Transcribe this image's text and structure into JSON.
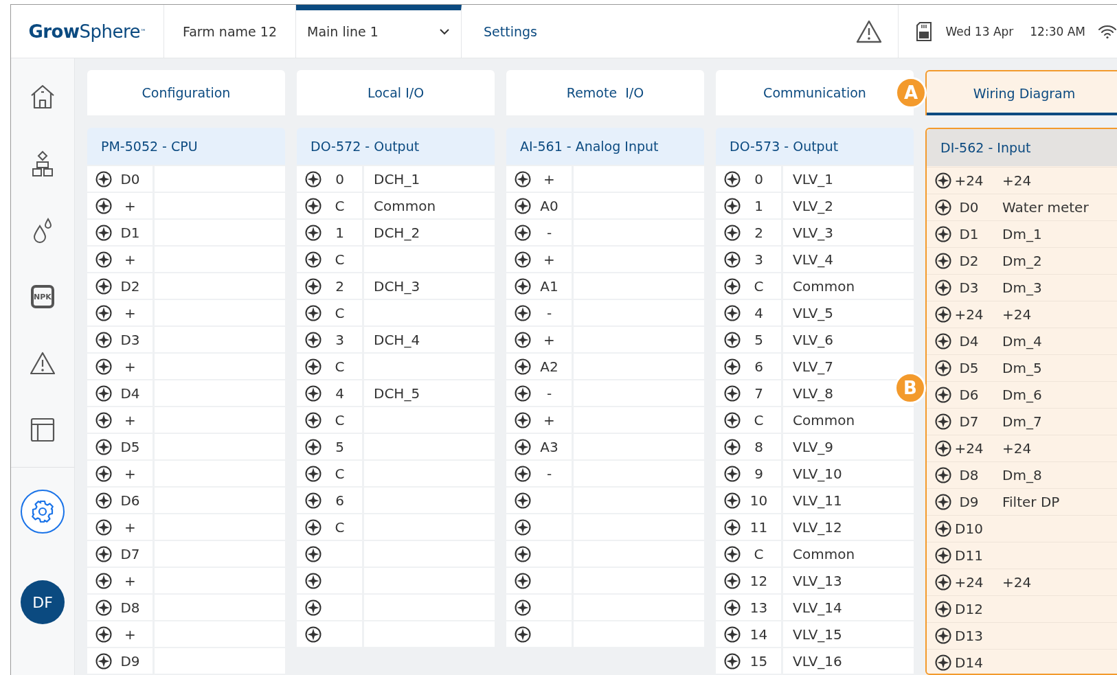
{
  "header": {
    "logo": "**Grow**Sphere$^{™}$",
    "farm": "Farm name 12",
    "line": {
      "label": "Main line 1",
      "selected": true
    },
    "settings": "Settings",
    "date": "Wed 13 Apr",
    "time": "12:30 AM"
  },
  "sidebar": {
    "items": [
      {
        "kind": "home",
        "selected": false
      },
      {
        "kind": "modules",
        "selected": false
      },
      {
        "kind": "drops",
        "selected": false
      },
      {
        "kind": "npk",
        "label": "NPK",
        "selected": false
      },
      {
        "kind": "alert",
        "selected": false
      },
      {
        "kind": "layout",
        "selected": false
      }
    ],
    "settings": {
      "selected": true
    },
    "avatar": "DF"
  },
  "tabs": [
    {
      "label": "Configuration",
      "selected": false
    },
    {
      "label": "Local I/O",
      "selected": false
    },
    {
      "label": "Remote  I/O",
      "selected": false
    },
    {
      "label": "Communication",
      "selected": false
    },
    {
      "label": "Wiring Diagram",
      "selected": true,
      "annotation": "A"
    }
  ],
  "modules": [
    {
      "title": "PM-5052 - CPU",
      "highlighted": false,
      "rows": [
        {
          "terminal": "D0",
          "name": ""
        },
        {
          "terminal": "+",
          "name": ""
        },
        {
          "terminal": "D1",
          "name": ""
        },
        {
          "terminal": "+",
          "name": ""
        },
        {
          "terminal": "D2",
          "name": ""
        },
        {
          "terminal": "+",
          "name": ""
        },
        {
          "terminal": "D3",
          "name": ""
        },
        {
          "terminal": "+",
          "name": ""
        },
        {
          "terminal": "D4",
          "name": ""
        },
        {
          "terminal": "+",
          "name": ""
        },
        {
          "terminal": "D5",
          "name": ""
        },
        {
          "terminal": "+",
          "name": ""
        },
        {
          "terminal": "D6",
          "name": ""
        },
        {
          "terminal": "+",
          "name": ""
        },
        {
          "terminal": "D7",
          "name": ""
        },
        {
          "terminal": "+",
          "name": ""
        },
        {
          "terminal": "D8",
          "name": ""
        },
        {
          "terminal": "+",
          "name": ""
        },
        {
          "terminal": "D9",
          "name": ""
        }
      ]
    },
    {
      "title": "DO-572 - Output",
      "highlighted": false,
      "rows": [
        {
          "terminal": "0",
          "name": "DCH_1"
        },
        {
          "terminal": "C",
          "name": "Common"
        },
        {
          "terminal": "1",
          "name": "DCH_2"
        },
        {
          "terminal": "C",
          "name": ""
        },
        {
          "terminal": "2",
          "name": "DCH_3"
        },
        {
          "terminal": "C",
          "name": ""
        },
        {
          "terminal": "3",
          "name": "DCH_4"
        },
        {
          "terminal": "C",
          "name": ""
        },
        {
          "terminal": "4",
          "name": "DCH_5"
        },
        {
          "terminal": "C",
          "name": ""
        },
        {
          "terminal": "5",
          "name": ""
        },
        {
          "terminal": "C",
          "name": ""
        },
        {
          "terminal": "6",
          "name": ""
        },
        {
          "terminal": "C",
          "name": ""
        },
        {
          "terminal": "",
          "name": ""
        },
        {
          "terminal": "",
          "name": ""
        },
        {
          "terminal": "",
          "name": ""
        },
        {
          "terminal": "",
          "name": ""
        }
      ]
    },
    {
      "title": "AI-561 - Analog Input",
      "highlighted": false,
      "rows": [
        {
          "terminal": "+",
          "name": ""
        },
        {
          "terminal": "A0",
          "name": ""
        },
        {
          "terminal": "-",
          "name": ""
        },
        {
          "terminal": "+",
          "name": ""
        },
        {
          "terminal": "A1",
          "name": ""
        },
        {
          "terminal": "-",
          "name": ""
        },
        {
          "terminal": "+",
          "name": ""
        },
        {
          "terminal": "A2",
          "name": ""
        },
        {
          "terminal": "-",
          "name": ""
        },
        {
          "terminal": "+",
          "name": ""
        },
        {
          "terminal": "A3",
          "name": ""
        },
        {
          "terminal": "-",
          "name": ""
        },
        {
          "terminal": "",
          "name": ""
        },
        {
          "terminal": "",
          "name": ""
        },
        {
          "terminal": "",
          "name": ""
        },
        {
          "terminal": "",
          "name": ""
        },
        {
          "terminal": "",
          "name": ""
        },
        {
          "terminal": "",
          "name": ""
        }
      ]
    },
    {
      "title": "DO-573 - Output",
      "highlighted": false,
      "rows": [
        {
          "terminal": "0",
          "name": "VLV_1"
        },
        {
          "terminal": "1",
          "name": "VLV_2"
        },
        {
          "terminal": "2",
          "name": "VLV_3"
        },
        {
          "terminal": "3",
          "name": "VLV_4"
        },
        {
          "terminal": "C",
          "name": "Common"
        },
        {
          "terminal": "4",
          "name": "VLV_5"
        },
        {
          "terminal": "5",
          "name": "VLV_6"
        },
        {
          "terminal": "6",
          "name": "VLV_7"
        },
        {
          "terminal": "7",
          "name": "VLV_8"
        },
        {
          "terminal": "C",
          "name": "Common"
        },
        {
          "terminal": "8",
          "name": "VLV_9"
        },
        {
          "terminal": "9",
          "name": "VLV_10"
        },
        {
          "terminal": "10",
          "name": "VLV_11"
        },
        {
          "terminal": "11",
          "name": "VLV_12"
        },
        {
          "terminal": "C",
          "name": "Common"
        },
        {
          "terminal": "12",
          "name": "VLV_13"
        },
        {
          "terminal": "13",
          "name": "VLV_14"
        },
        {
          "terminal": "14",
          "name": "VLV_15"
        },
        {
          "terminal": "15",
          "name": "VLV_16"
        }
      ]
    },
    {
      "title": "DI-562 - Input",
      "highlighted": true,
      "annotation": "B",
      "rows": [
        {
          "terminal": "+24",
          "name": "+24"
        },
        {
          "terminal": "D0",
          "name": "Water meter"
        },
        {
          "terminal": "D1",
          "name": "Dm_1"
        },
        {
          "terminal": "D2",
          "name": "Dm_2"
        },
        {
          "terminal": "D3",
          "name": "Dm_3"
        },
        {
          "terminal": "+24",
          "name": "+24"
        },
        {
          "terminal": "D4",
          "name": "Dm_4"
        },
        {
          "terminal": "D5",
          "name": "Dm_5"
        },
        {
          "terminal": "D6",
          "name": "Dm_6"
        },
        {
          "terminal": "D7",
          "name": "Dm_7"
        },
        {
          "terminal": "+24",
          "name": "+24"
        },
        {
          "terminal": "D8",
          "name": "Dm_8"
        },
        {
          "terminal": "D9",
          "name": "Filter DP"
        },
        {
          "terminal": "D10",
          "name": ""
        },
        {
          "terminal": "D11",
          "name": ""
        },
        {
          "terminal": "+24",
          "name": "+24"
        },
        {
          "terminal": "D12",
          "name": ""
        },
        {
          "terminal": "D13",
          "name": ""
        },
        {
          "terminal": "D14",
          "name": ""
        }
      ]
    }
  ]
}
